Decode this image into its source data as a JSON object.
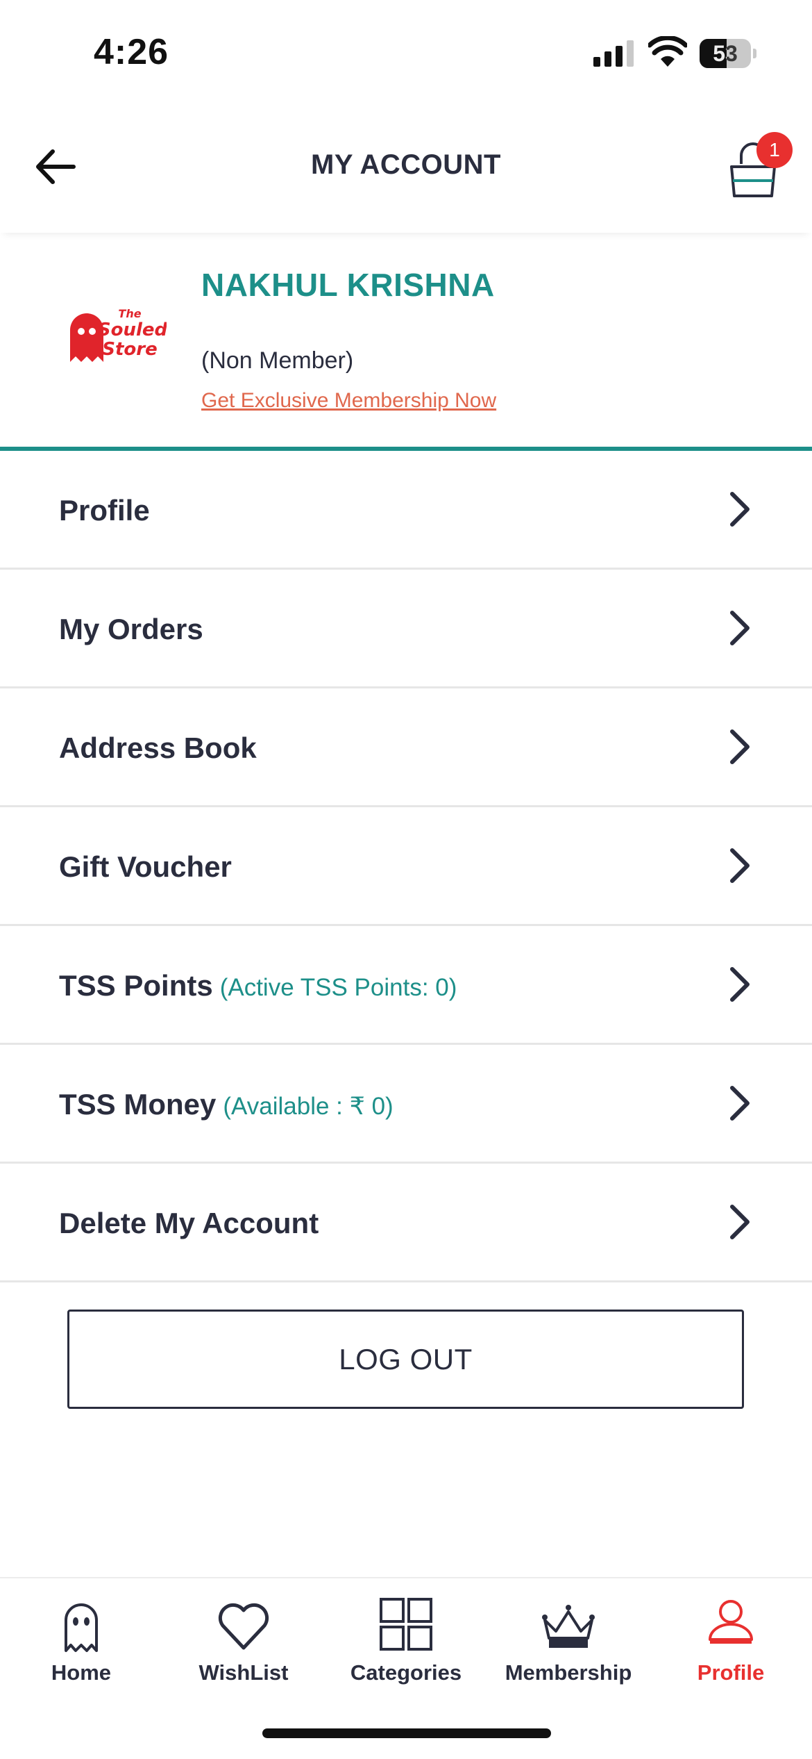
{
  "status_bar": {
    "time": "4:26",
    "battery": "53",
    "battery_level": 0.53
  },
  "header": {
    "title": "MY ACCOUNT",
    "cart_count": "1"
  },
  "profile": {
    "name": "NAKHUL KRISHNA",
    "status": "(Non Member)",
    "membership_link": "Get Exclusive Membership Now",
    "logo_text": "The Souled Store"
  },
  "menu": [
    {
      "label": "Profile",
      "sub": ""
    },
    {
      "label": "My Orders",
      "sub": ""
    },
    {
      "label": "Address Book",
      "sub": ""
    },
    {
      "label": "Gift Voucher",
      "sub": ""
    },
    {
      "label": "TSS Points",
      "sub": "(Active TSS Points: 0)"
    },
    {
      "label": "TSS Money",
      "sub": "(Available : ₹ 0)"
    },
    {
      "label": "Delete My Account",
      "sub": ""
    }
  ],
  "logout_label": "LOG OUT",
  "bottom_nav": [
    {
      "label": "Home",
      "icon": "ghost-icon"
    },
    {
      "label": "WishList",
      "icon": "heart-icon"
    },
    {
      "label": "Categories",
      "icon": "grid-icon"
    },
    {
      "label": "Membership",
      "icon": "crown-icon"
    },
    {
      "label": "Profile",
      "icon": "user-icon",
      "active": true
    }
  ],
  "colors": {
    "accent": "#1d8f89",
    "link": "#e0684d",
    "active": "#e8302f",
    "text": "#2a2d3e"
  }
}
